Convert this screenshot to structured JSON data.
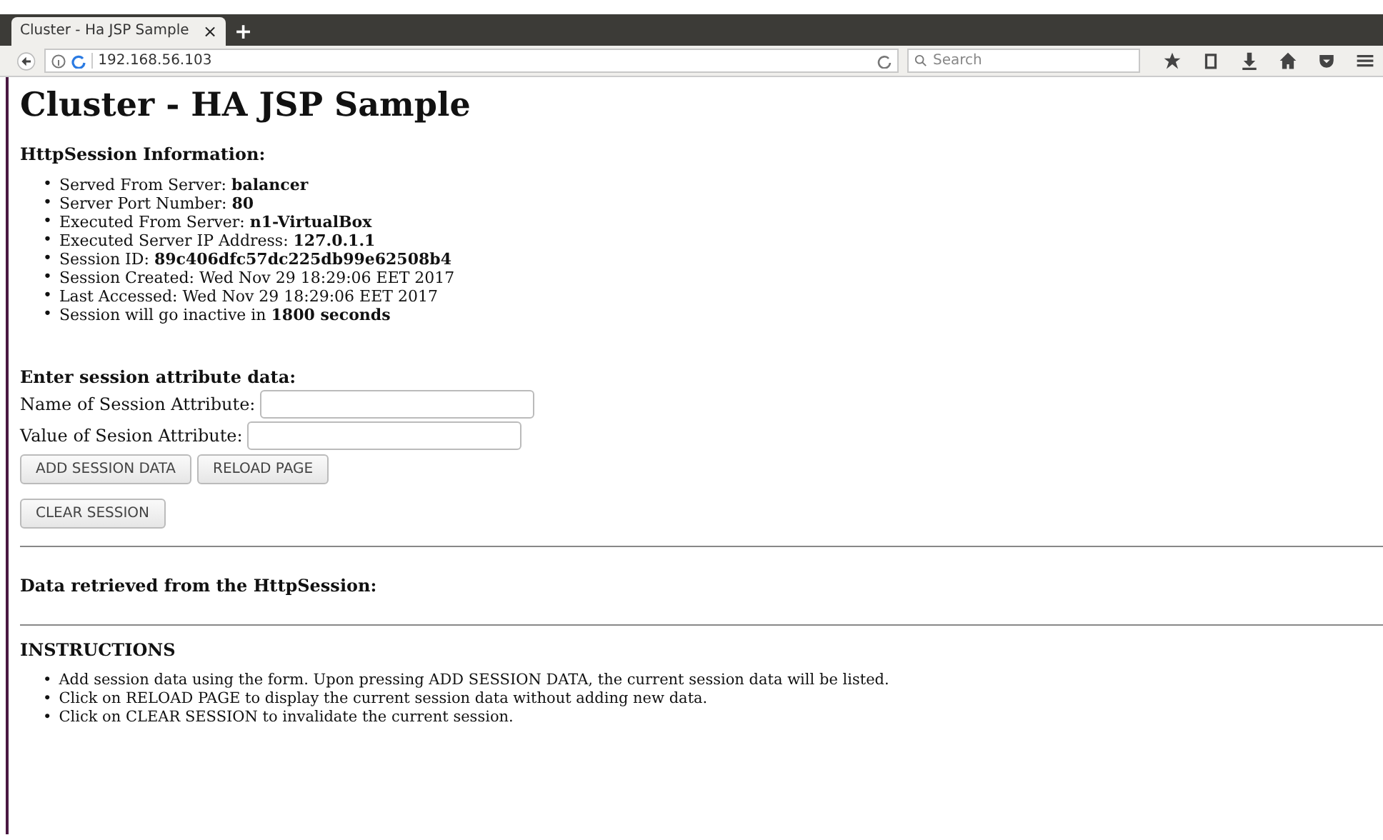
{
  "browser": {
    "tab": {
      "title": "Cluster - Ha JSP Sample",
      "close": "×",
      "selected": true
    },
    "new_tab": "+",
    "address": "192.168.56.103",
    "search": {
      "placeholder": "Search"
    }
  },
  "page": {
    "title": "Cluster - HA JSP Sample",
    "info_heading": "HttpSession Information:",
    "info_items": [
      {
        "marker": "•",
        "text": "Served From Server: **balancer**"
      },
      {
        "marker": "•",
        "text": "Server Port Number: **80**"
      },
      {
        "marker": "•",
        "text": "Executed From Server: **n1-VirtualBox**"
      },
      {
        "marker": "•",
        "text": "Executed Server IP Address: **127.0.1.1**"
      },
      {
        "marker": "•",
        "text": "Session ID: **89c406dfc57dc225db99e62508b4**"
      },
      {
        "marker": "•",
        "text": "Session Created: Wed Nov 29 18:29:06 EET 2017"
      },
      {
        "marker": "•",
        "text": "Last Accessed: Wed Nov 29 18:29:06 EET 2017"
      },
      {
        "marker": "•",
        "text": "Session will go inactive in **1800 seconds**"
      }
    ],
    "form_heading": "Enter session attribute data:",
    "fields": [
      {
        "label": "Name of Session Attribute:"
      },
      {
        "label": "Value of Sesion Attribute:"
      }
    ],
    "buttons": [
      "ADD SESSION DATA",
      "RELOAD PAGE"
    ],
    "clear_button": "CLEAR SESSION",
    "retrieved_heading": "Data retrieved from the HttpSession:",
    "instructions_heading": "INSTRUCTIONS",
    "instructions": [
      {
        "marker": "•",
        "text": "Add session data using the form. Upon pressing ADD SESSION DATA, the current session data will be listed."
      },
      {
        "marker": "•",
        "text": "Click on RELOAD PAGE to display the current session data without adding new data."
      },
      {
        "marker": "•",
        "text": "Click on CLEAR SESSION to invalidate the current session."
      }
    ]
  }
}
